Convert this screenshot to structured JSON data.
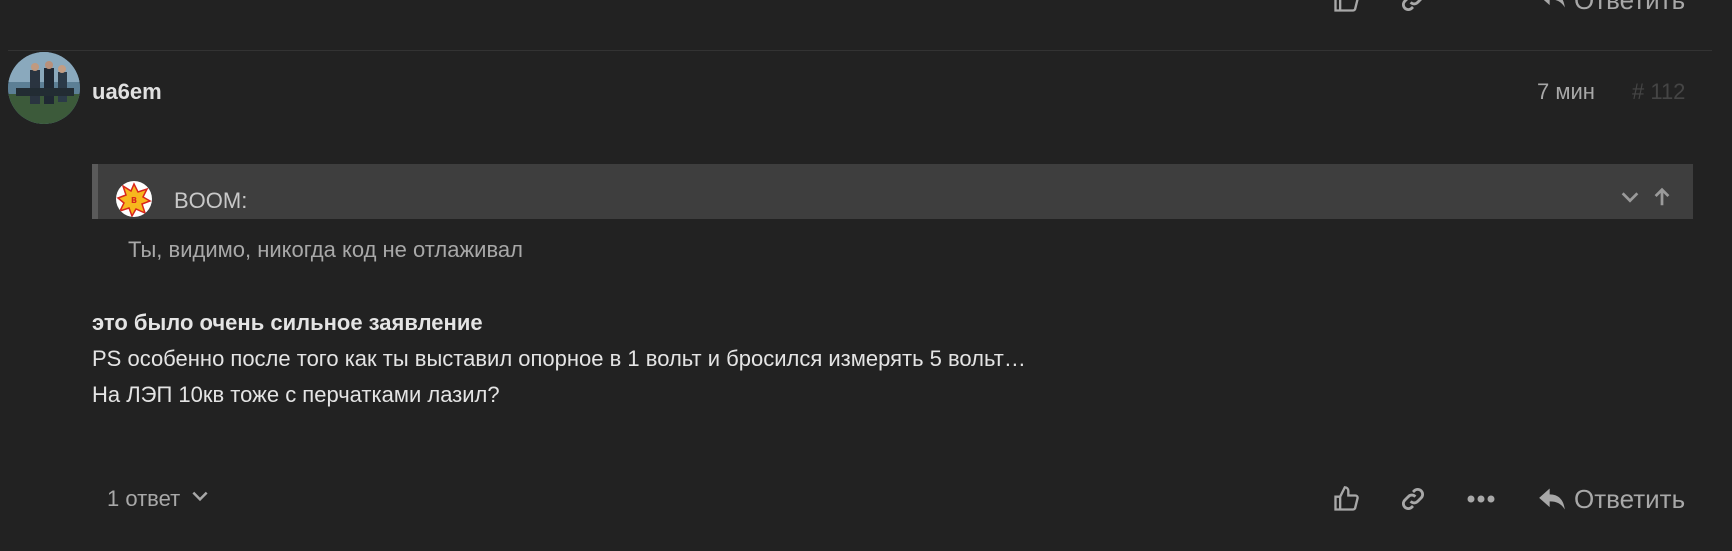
{
  "top_controls": {
    "reply_label": "Ответить"
  },
  "post": {
    "username": "ua6em",
    "time": "7 мин",
    "number": "# 112",
    "quote": {
      "author": "BOOM:",
      "text": "Ты, видимо, никогда код не отлаживал"
    },
    "body": {
      "line1": "это было очень сильное заявление",
      "line2": "PS особенно после того как ты выставил опорное в 1 вольт и бросился измерять 5 вольт…",
      "line3": "На ЛЭП 10кв тоже с перчатками лазил?"
    },
    "footer": {
      "replies_label": "1 ответ",
      "reply_label": "Ответить"
    }
  },
  "colors": {
    "background": "#222222",
    "quote_background": "#3e3e3e",
    "muted_text": "#a8a8a8"
  }
}
